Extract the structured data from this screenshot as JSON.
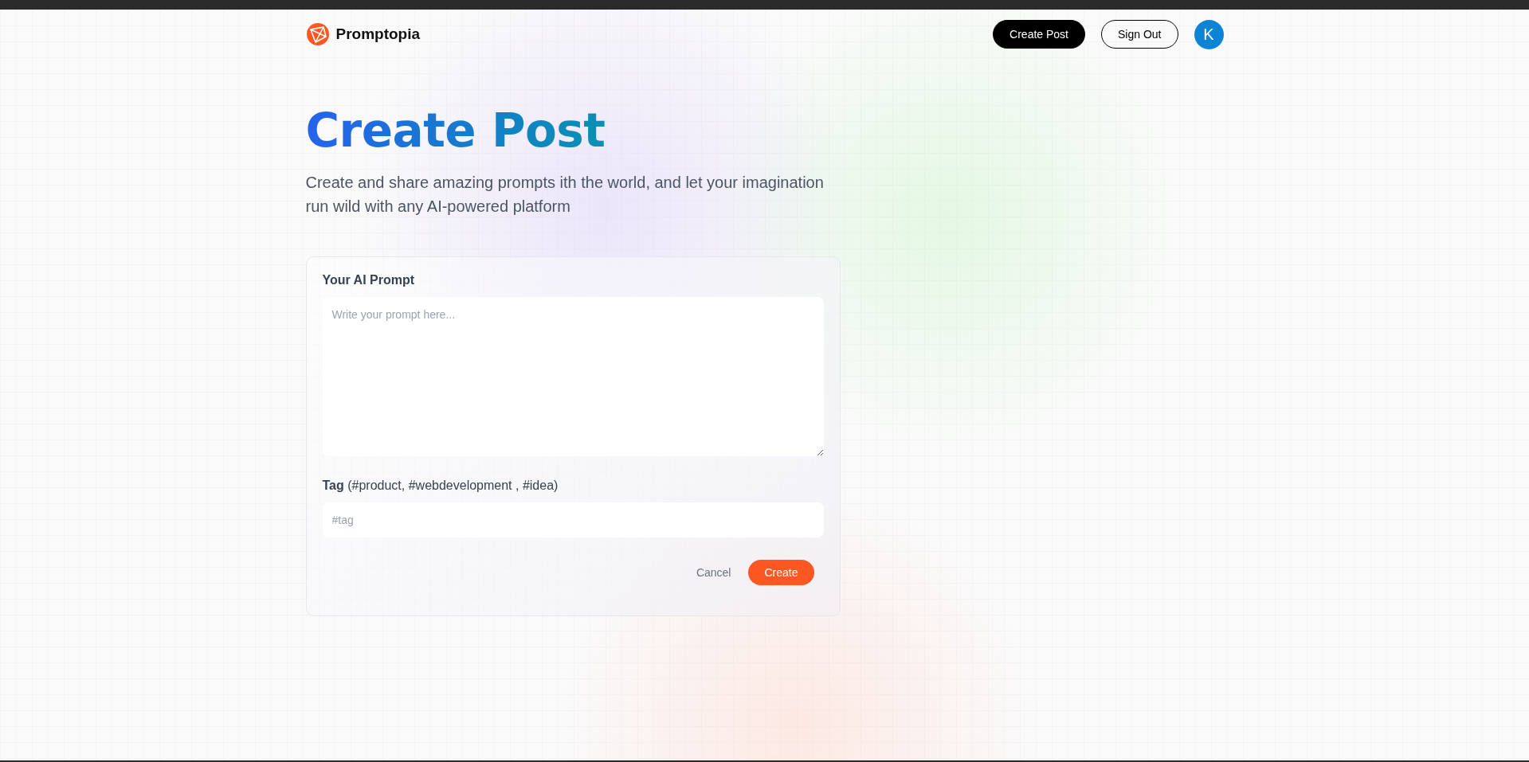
{
  "nav": {
    "brand": "Promptopia",
    "buttons": [
      {
        "label": "Create Post",
        "kind": "primary"
      },
      {
        "label": "Sign Out",
        "kind": "outline"
      }
    ],
    "avatar": "K"
  },
  "hero": {
    "title": "Create Post",
    "subtitle": "Create and share amazing prompts ith the world, and let your imagination run wild with any AI-powered platform"
  },
  "form": {
    "prompt_label": "Your AI Prompt",
    "prompt_placeholder": "Write your prompt here...",
    "tag_label": "**Tag** (#product, #webdevelopment , #idea)",
    "tag_placeholder": "#tag",
    "cancel": "Cancel",
    "submit": "Create"
  }
}
